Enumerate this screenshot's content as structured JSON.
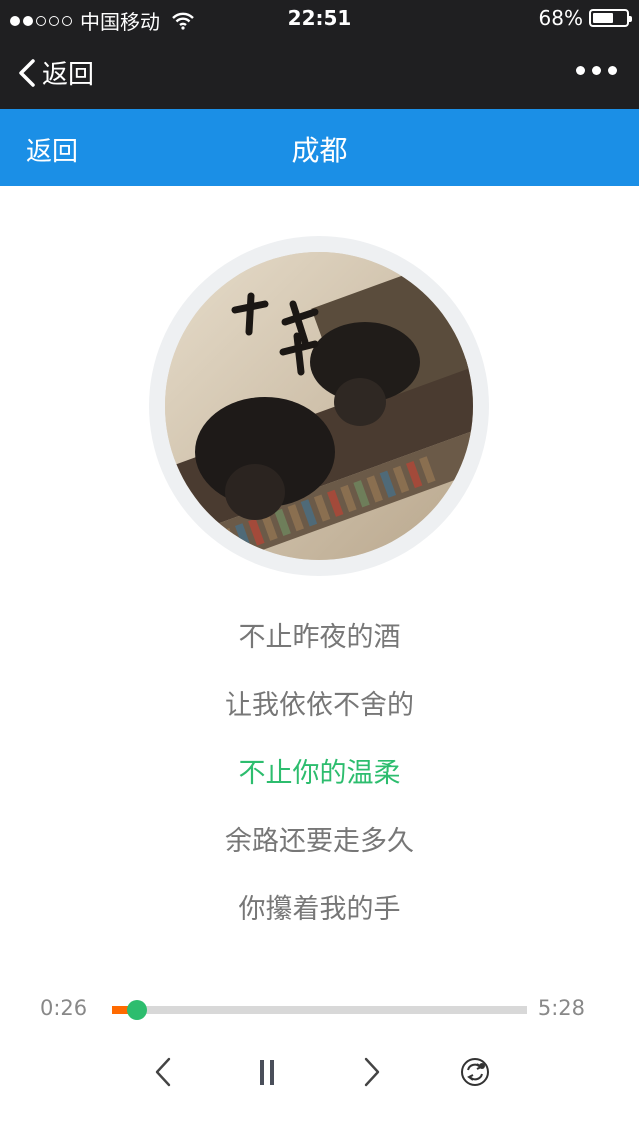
{
  "status_bar": {
    "carrier": "中国移动",
    "time": "22:51",
    "battery": "68%",
    "battery_level": 0.68,
    "signal_bars_filled": 2,
    "signal_bars_total": 5
  },
  "wechat_nav": {
    "back_label": "返回"
  },
  "header": {
    "back_label": "返回",
    "title": "成都"
  },
  "lyrics": [
    {
      "text": "不止昨夜的酒",
      "active": false
    },
    {
      "text": "让我依依不舍的",
      "active": false
    },
    {
      "text": "不止你的温柔",
      "active": true
    },
    {
      "text": "余路还要走多久",
      "active": false
    },
    {
      "text": "你攥着我的手",
      "active": false
    }
  ],
  "player": {
    "current_time": "0:26",
    "total_time": "5:28",
    "progress": 0.06,
    "controls": [
      "previous",
      "pause",
      "next",
      "loop"
    ]
  },
  "colors": {
    "header_blue": "#1b8fe6",
    "active_lyric_green": "#2dbd6e",
    "progress_orange": "#ff6a00",
    "dark_bar": "#1f1f21"
  }
}
